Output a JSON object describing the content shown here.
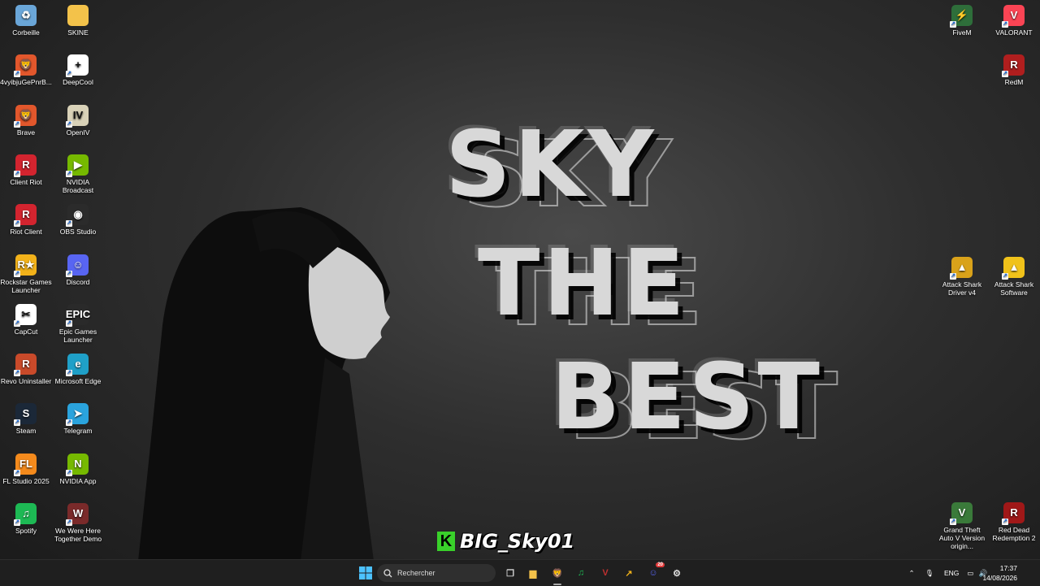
{
  "wallpaper": {
    "line1": "SKY",
    "line2": "THE",
    "line3": "BEST",
    "tag": "BIG_Sky01",
    "tag_badge": "K"
  },
  "desktop_left_col1": [
    {
      "label": "Corbeille",
      "icon": "recycle-bin-icon",
      "color": "#6aa6d8",
      "glyph": "♻"
    },
    {
      "label": "4vyibjuGePnrB...",
      "icon": "brave-icon",
      "color": "#e2572c",
      "glyph": "🦁"
    },
    {
      "label": "Brave",
      "icon": "brave-icon",
      "color": "#e2572c",
      "glyph": "🦁"
    },
    {
      "label": "Client Riot",
      "icon": "riot-icon",
      "color": "#d3242f",
      "glyph": "R"
    },
    {
      "label": "Riot Client",
      "icon": "riot-icon",
      "color": "#d3242f",
      "glyph": "R"
    },
    {
      "label": "Rockstar Games Launcher",
      "icon": "rockstar-icon",
      "color": "#f2b21a",
      "glyph": "R★"
    },
    {
      "label": "CapCut",
      "icon": "capcut-icon",
      "color": "#ffffff",
      "glyph": "✂"
    },
    {
      "label": "Revo Uninstaller",
      "icon": "revo-icon",
      "color": "#c94a2a",
      "glyph": "R"
    },
    {
      "label": "Steam",
      "icon": "steam-icon",
      "color": "#1b2838",
      "glyph": "S"
    },
    {
      "label": "FL Studio 2025",
      "icon": "fl-studio-icon",
      "color": "#f48a1c",
      "glyph": "FL"
    },
    {
      "label": "Spotify",
      "icon": "spotify-icon",
      "color": "#1db954",
      "glyph": "♫"
    }
  ],
  "desktop_left_col2": [
    {
      "label": "SKINE",
      "icon": "folder-icon",
      "color": "#f3c24a",
      "glyph": ""
    },
    {
      "label": "DeepCool",
      "icon": "deepcool-icon",
      "color": "#ffffff",
      "glyph": "+"
    },
    {
      "label": "OpenIV",
      "icon": "openiv-icon",
      "color": "#d9d2b8",
      "glyph": "IV"
    },
    {
      "label": "NVIDIA Broadcast",
      "icon": "nvidia-broadcast-icon",
      "color": "#76b900",
      "glyph": "▶"
    },
    {
      "label": "OBS Studio",
      "icon": "obs-icon",
      "color": "#2b2b2b",
      "glyph": "◉"
    },
    {
      "label": "Discord",
      "icon": "discord-icon",
      "color": "#5865f2",
      "glyph": "☺"
    },
    {
      "label": "Epic Games Launcher",
      "icon": "epic-games-icon",
      "color": "#2a2a2a",
      "glyph": "EPIC"
    },
    {
      "label": "Microsoft Edge",
      "icon": "edge-icon",
      "color": "#1fa0c8",
      "glyph": "e"
    },
    {
      "label": "Telegram",
      "icon": "telegram-icon",
      "color": "#2aa3dd",
      "glyph": "➤"
    },
    {
      "label": "NVIDIA App",
      "icon": "nvidia-icon",
      "color": "#76b900",
      "glyph": "N"
    },
    {
      "label": "We Were Here Together Demo",
      "icon": "game-icon",
      "color": "#7a2a2a",
      "glyph": "W"
    }
  ],
  "desktop_right": [
    {
      "label": "FiveM",
      "icon": "fivem-icon",
      "color": "#2e6e3a",
      "glyph": "⚡"
    },
    {
      "label": "VALORANT",
      "icon": "valorant-icon",
      "color": "#fa4454",
      "glyph": "V"
    },
    {
      "label": "RedM",
      "icon": "redm-icon",
      "color": "#b01e1e",
      "glyph": "R"
    },
    {
      "label": "Attack Shark Driver v4",
      "icon": "attack-shark-icon",
      "color": "#d9a21a",
      "glyph": "▲"
    },
    {
      "label": "Attack Shark Software",
      "icon": "attack-shark-icon",
      "color": "#f0c21a",
      "glyph": "▲"
    },
    {
      "label": "Grand Theft Auto V Version origin...",
      "icon": "gta-icon",
      "color": "#3a7a3a",
      "glyph": "V"
    },
    {
      "label": "Red Dead Redemption 2",
      "icon": "rdr2-icon",
      "color": "#a01818",
      "glyph": "R"
    }
  ],
  "taskbar": {
    "search_placeholder": "Rechercher",
    "pinned": [
      {
        "name": "task-view-icon",
        "color": "#d0d0d0",
        "glyph": "❐"
      },
      {
        "name": "file-explorer-icon",
        "color": "#f3c24a",
        "glyph": "▆"
      },
      {
        "name": "brave-icon",
        "color": "#e2572c",
        "glyph": "🦁"
      },
      {
        "name": "spotify-icon",
        "color": "#1db954",
        "glyph": "♫"
      },
      {
        "name": "voicemeeter-icon",
        "color": "#c03030",
        "glyph": "V"
      },
      {
        "name": "norton-icon",
        "color": "#f0b21a",
        "glyph": "↗"
      },
      {
        "name": "discord-icon",
        "color": "#5865f2",
        "glyph": "☺"
      },
      {
        "name": "app-icon",
        "color": "#dddddd",
        "glyph": "⚙"
      }
    ],
    "discord_badge": "20",
    "language": "ENG",
    "time": "17:37",
    "date": "14/08/2026"
  }
}
